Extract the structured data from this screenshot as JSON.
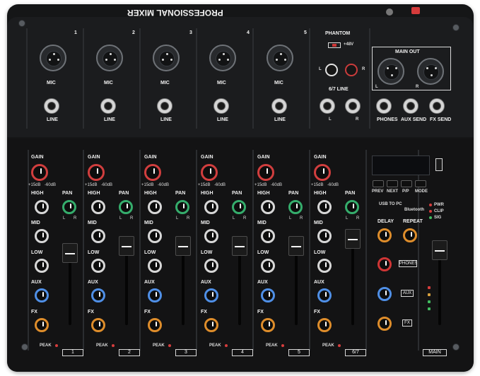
{
  "brand": "PROFESSIONAL MIXER",
  "top_labels": {
    "channels": [
      "1",
      "2",
      "3",
      "4",
      "5"
    ],
    "mic": "MIC",
    "line": "LINE",
    "phantom": "PHANTOM",
    "plus48v": "+48V",
    "line67": "6/7 LINE",
    "left": "L",
    "right": "R",
    "main_out": "MAIN OUT",
    "phones": "PHONES",
    "aux_send": "AUX SEND",
    "fx_send": "FX SEND"
  },
  "strip_labels": {
    "gain": "GAIN",
    "high": "HIGH",
    "pan": "PAN",
    "mid": "MID",
    "low": "LOW",
    "aux": "AUX",
    "fx": "FX",
    "peak": "PEAK",
    "gain_scale": [
      "+15dB",
      "-60dB"
    ],
    "pan_scale": [
      "L",
      "R"
    ]
  },
  "channel_numbers": [
    "1",
    "2",
    "3",
    "4",
    "5",
    "6/7"
  ],
  "effects": {
    "delay": "DELAY",
    "repeat": "REPEAT",
    "phones": "PHONES",
    "aux": "AUX",
    "fx": "FX",
    "main": "MAIN"
  },
  "media_controls": {
    "prev": "PREV",
    "next": "NEXT",
    "pp": "P/P",
    "mode": "MODE",
    "usb_to_pc": "USB TO PC",
    "bluetooth": "Bluetooth"
  },
  "status_leds": {
    "pwr": "PWR",
    "clip": "CLIP",
    "sig": "SIG"
  },
  "colors": {
    "accent_red": "#d53b3b",
    "accent_green": "#35ad6c",
    "accent_blue": "#4f8fe6",
    "accent_orange": "#de8d2b",
    "panel": "#151617"
  }
}
